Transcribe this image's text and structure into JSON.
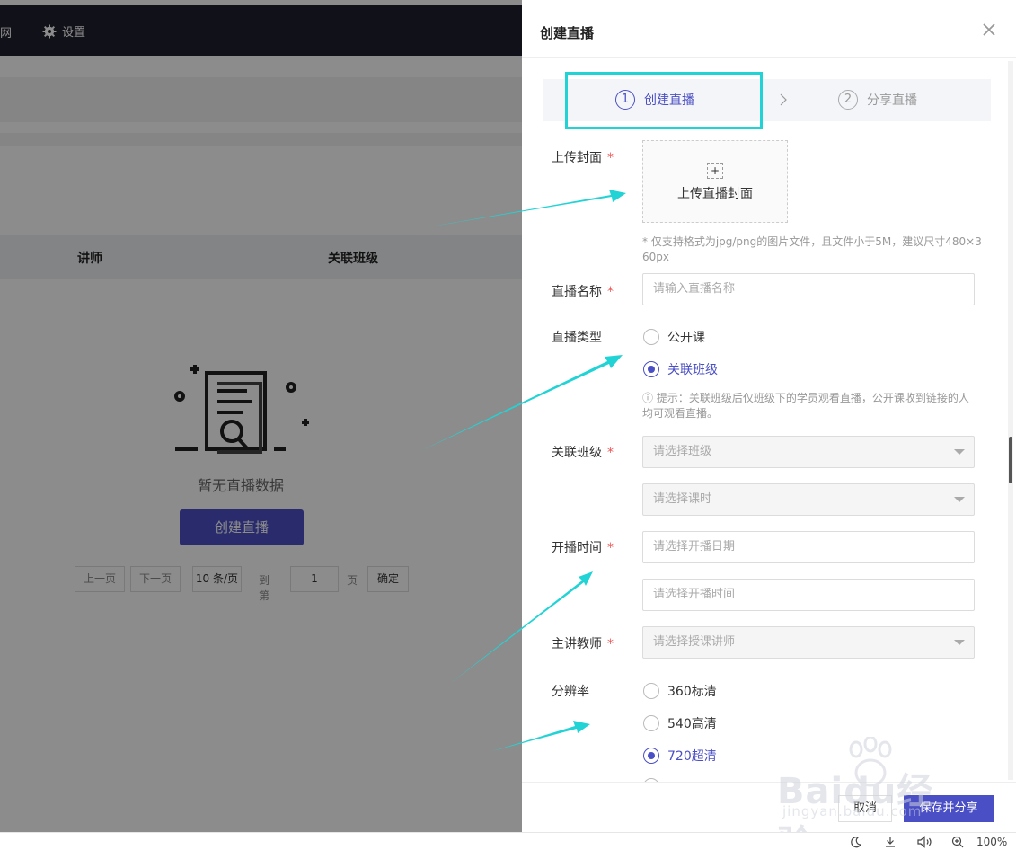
{
  "background": {
    "nav_fragment": "网",
    "settings_label": "设置",
    "table_headers": [
      "讲师",
      "关联班级"
    ],
    "empty_text": "暂无直播数据",
    "create_button": "创建直播",
    "pager": {
      "prev": "上一页",
      "next": "下一页",
      "page_size": "10 条/页",
      "goto_label": "到第",
      "goto_value": "1",
      "page_unit": "页",
      "confirm": "确定"
    }
  },
  "drawer": {
    "title": "创建直播",
    "steps": [
      {
        "num": "1",
        "label": "创建直播",
        "active": true
      },
      {
        "num": "2",
        "label": "分享直播",
        "active": false
      }
    ],
    "cover": {
      "label": "上传封面",
      "upload_text": "上传直播封面",
      "plus": "+",
      "hint_line1": "* 仅支持格式为jpg/png的图片文件，且文件小于5M，建议尺寸480×3",
      "hint_line2": "60px"
    },
    "name": {
      "label": "直播名称",
      "placeholder": "请输入直播名称"
    },
    "type": {
      "label": "直播类型",
      "options": [
        "公开课",
        "关联班级"
      ],
      "selected": "关联班级",
      "hint_line1": "ⓘ 提示：关联班级后仅班级下的学员观看直播，公开课收到链接的人",
      "hint_line2": "均可观看直播。"
    },
    "class": {
      "label": "关联班级",
      "class_placeholder": "请选择班级",
      "lesson_placeholder": "请选择课时"
    },
    "time": {
      "label": "开播时间",
      "date_placeholder": "请选择开播日期",
      "time_placeholder": "请选择开播时间"
    },
    "teacher": {
      "label": "主讲教师",
      "placeholder": "请选择授课讲师"
    },
    "resolution": {
      "label": "分辨率",
      "options": [
        "360标清",
        "540高清",
        "720超清"
      ],
      "selected": "720超清"
    },
    "required_mark": "*",
    "footer": {
      "cancel": "取消",
      "save": "保存并分享"
    }
  },
  "watermark": {
    "main": "Baidu经验",
    "sub": "jingyan.baidu.com"
  },
  "statusbar": {
    "zoom": "100%"
  },
  "colors": {
    "accent": "#4b4fc5",
    "highlight": "#22d3d6",
    "required": "#ee5555"
  }
}
